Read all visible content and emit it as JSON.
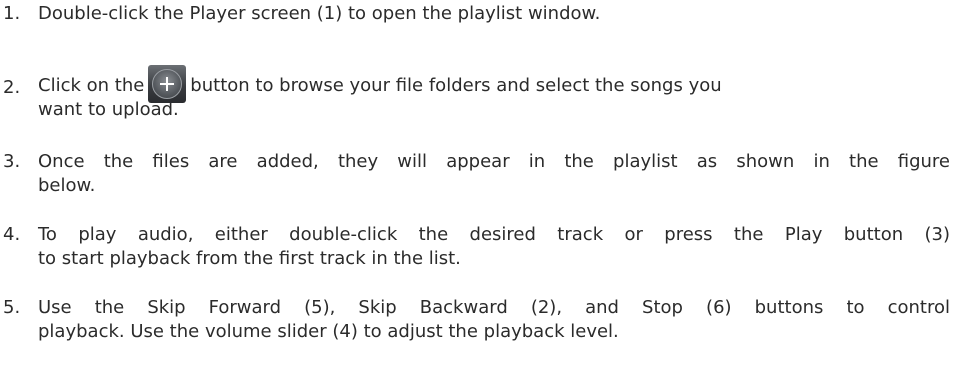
{
  "steps": [
    {
      "number": "1.",
      "line1": "Double-click the Player screen (1) to open the playlist window.",
      "line2": ""
    },
    {
      "number": "2.",
      "before_icon": "Click on the",
      "icon": "plus-circle-icon",
      "after_icon": "button to browse your file folders and select the songs you",
      "line2": "want to upload."
    },
    {
      "number": "3.",
      "line1": "Once the files are added, they will appear in the playlist as shown in the figure",
      "line2": "below."
    },
    {
      "number": "4.",
      "line1": "To play audio, either double-click the desired track or press the Play button (3)",
      "line2": "to start playback from the first track in the list."
    },
    {
      "number": "5.",
      "line1": "Use the Skip Forward (5), Skip Backward (2), and Stop (6) buttons to control",
      "line2": "playback. Use the volume slider (4) to adjust the playback level."
    }
  ],
  "colors": {
    "text": "#2b2b2b",
    "icon_background": "#3a3d41",
    "icon_glyph": "#ffffff"
  }
}
